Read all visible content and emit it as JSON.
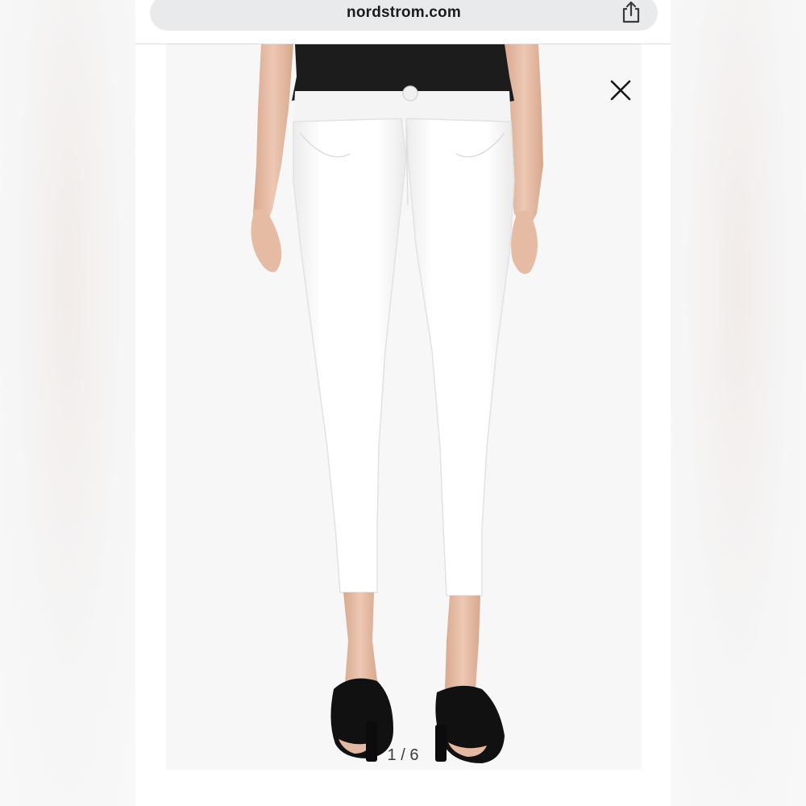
{
  "browser": {
    "url": "nordstrom.com",
    "share_icon": "share-icon"
  },
  "viewer": {
    "close_icon": "close-icon",
    "image_subject": "white cropped skinny jeans with black top and black mule sandals",
    "pager": "1 / 6"
  },
  "colors": {
    "url_bar_bg": "#e9eaec",
    "photo_bg": "#f7f7f7",
    "jeans": "#ffffff",
    "top": "#1c1c1c",
    "shoes": "#111111",
    "skin": "#e8c2ad"
  }
}
